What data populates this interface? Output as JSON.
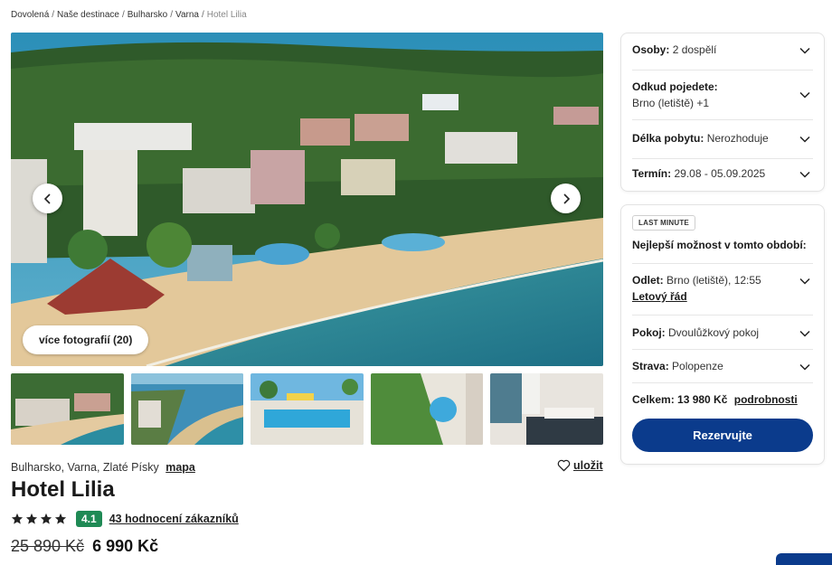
{
  "breadcrumb": {
    "items": [
      "Dovolená",
      "Naše destinace",
      "Bulharsko",
      "Varna"
    ],
    "current": "Hotel Lilia",
    "separator": "/"
  },
  "gallery": {
    "more_photos_label": "více fotografií (20)",
    "thumbnail_count": 5
  },
  "hotel": {
    "location": "Bulharsko, Varna, Zlaté Písky",
    "map_label": "mapa",
    "save_label": "uložit",
    "name": "Hotel Lilia",
    "stars": 4,
    "score": "4.1",
    "reviews_label": "43 hodnocení zákazníků",
    "old_price": "25 890 Kč",
    "new_price": "6 990 Kč"
  },
  "search_panel": {
    "persons": {
      "label": "Osoby:",
      "value": "2 dospělí"
    },
    "departure": {
      "label": "Odkud pojedete:",
      "value": "Brno (letiště) +1"
    },
    "length": {
      "label": "Délka pobytu:",
      "value": "Nerozhoduje"
    },
    "term": {
      "label": "Termín:",
      "value": "29.08 - 05.09.2025"
    }
  },
  "offer_panel": {
    "badge": "LAST MINUTE",
    "best_option": "Nejlepší možnost v tomto období:",
    "flight": {
      "label": "Odlet:",
      "value": "Brno (letiště), 12:55",
      "schedule_link": "Letový řád"
    },
    "room": {
      "label": "Pokoj:",
      "value": "Dvoulůžkový pokoj"
    },
    "board": {
      "label": "Strava:",
      "value": "Polopenze"
    },
    "total": {
      "label": "Celkem: 13 980 Kč",
      "details_link": "podrobnosti"
    },
    "reserve_label": "Rezervujte"
  },
  "colors": {
    "primary": "#0b3b8c",
    "score_badge": "#1f8a55"
  }
}
